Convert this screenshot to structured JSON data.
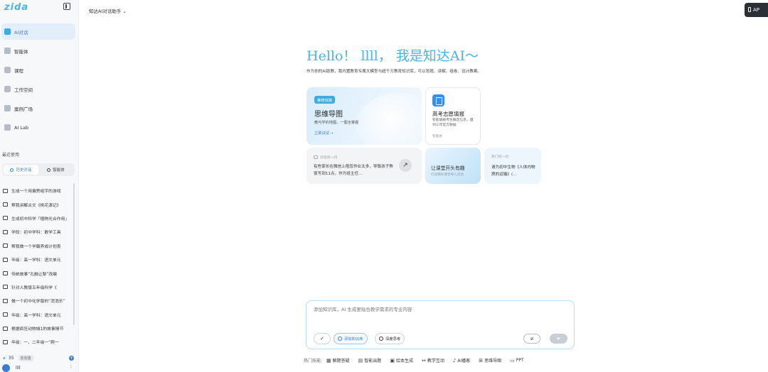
{
  "sidebar": {
    "logo": "zida",
    "nav": [
      {
        "label": "AI对话",
        "icon": "chat-cube-icon",
        "active": true
      },
      {
        "label": "智能体",
        "icon": "grid-icon",
        "active": false
      },
      {
        "label": "课程",
        "icon": "book-icon",
        "active": false
      },
      {
        "label": "工作空间",
        "icon": "cloud-icon",
        "active": false
      },
      {
        "label": "案例广场",
        "icon": "case-icon",
        "active": false
      },
      {
        "label": "AI Lab",
        "icon": "sparkle-icon",
        "active": false
      }
    ],
    "recent_title": "最近使用",
    "toggle": {
      "history": "历史对话",
      "agents": "智能体"
    },
    "history": [
      "生成一个用偏旁组字的游戏",
      "帮我讲解古文《桃花源记》",
      "生成初中科学「植物光合作用」",
      "学段：初中学科：数学工具",
      "帮我做一个学霸养成计划表",
      "年级：高一学科：语文单元",
      "传统故事“孔融让梨”改编",
      "针对人教版五年级科学《",
      "做一个初中化学版的“消消乐”",
      "年级：高一学科：语文单元",
      "根据疯狂动物城1的故事情节",
      "年级：一、二年级一“爬一"
    ],
    "credits": "35",
    "recharge": "去充值",
    "username": "llll"
  },
  "topbar": {
    "model": "知达AI对话助手",
    "api_label": "AP"
  },
  "hero": {
    "title": "Hello！ llll， 我是知达AI～",
    "subtitle": "作为你的AI助教，我内置教育专属大模型与超千万教育知识库，可以答题、讲解、组卷、设计教案。"
  },
  "cards": {
    "mind": {
      "badge": "推荐技能",
      "title": "思维导图",
      "desc": "教与学的地图，一图全掌握",
      "link": "立即试试 →"
    },
    "college": {
      "title": "高考志愿填报",
      "desc": "智能填报考生确定信息，遇到三年官方数据",
      "foot": "智能体"
    },
    "parent": {
      "tag": "对话问一问",
      "text": "有些家长在微信上抱怨作业太多，导致孩子熬夜写到11点，作为班主任…"
    },
    "class": {
      "title": "让课堂开头有趣",
      "desc": "打造精彩课堂导入活动"
    },
    "bio": {
      "tag": "热门问一问",
      "text": "请为初中生物《人体内物质的运输》(…"
    }
  },
  "input": {
    "placeholder": "添加知识库，AI 生成更贴合教学需求的专业内容",
    "check": "✓",
    "kb_chip": "添加知识库",
    "deep_chip": "深度思考"
  },
  "skills": {
    "label": "热门技能:",
    "items": [
      {
        "label": "解题答疑",
        "icon": "▦"
      },
      {
        "label": "智能出题",
        "icon": "▤"
      },
      {
        "label": "绘本生成",
        "icon": "▣"
      },
      {
        "label": "教学互动",
        "icon": "↔"
      },
      {
        "label": "AI播客",
        "icon": "♪"
      },
      {
        "label": "思维导图",
        "icon": "⊞"
      },
      {
        "label": "PPT",
        "icon": "▭"
      }
    ]
  }
}
